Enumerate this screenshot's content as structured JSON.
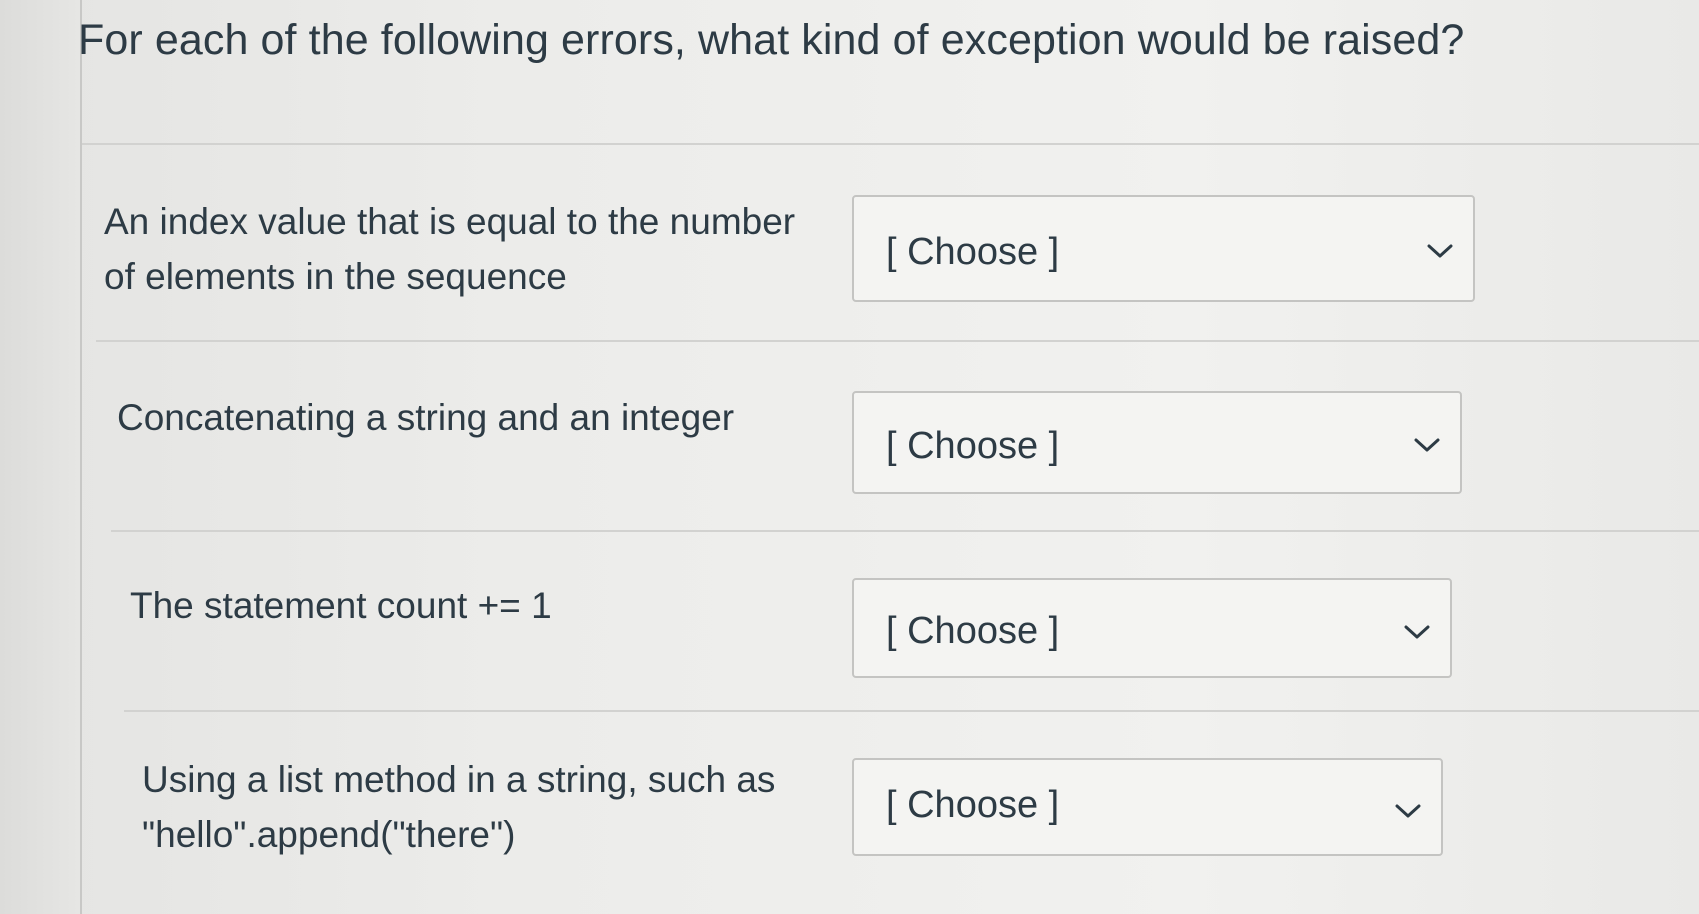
{
  "question": {
    "title": "For each of the following errors, what kind of exception would be raised?"
  },
  "rows": [
    {
      "label_line1": "An index value that is equal to the number",
      "label_line2": "of elements in the sequence",
      "select_value": "[ Choose ]",
      "icon": "chevron-down-icon"
    },
    {
      "label_line1": "Concatenating a string and an integer",
      "select_value": "[ Choose ]",
      "icon": "chevron-down-icon"
    },
    {
      "label_line1": "The statement count += 1",
      "select_value": "[ Choose ]",
      "icon": "chevron-down-icon"
    },
    {
      "label_line1": "Using a list method in a string, such as",
      "label_line2": "\"hello\".append(\"there\")",
      "select_value": "[ Choose ]",
      "icon": "chevron-down-icon"
    }
  ],
  "colors": {
    "text": "#2d3b45",
    "select_border": "#c4c4c2",
    "divider": "#d2d2d0"
  }
}
